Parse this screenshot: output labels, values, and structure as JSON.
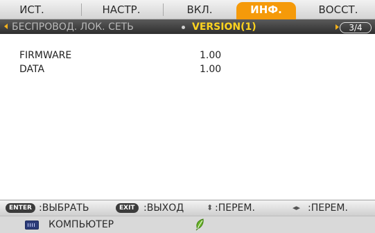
{
  "tabs": [
    {
      "label": "ИСТ.",
      "active": false
    },
    {
      "label": "НАСТР.",
      "active": false
    },
    {
      "label": "ВКЛ.",
      "active": false
    },
    {
      "label": "ИНФ.",
      "active": true
    },
    {
      "label": "ВОССТ.",
      "active": false
    }
  ],
  "subtabs": {
    "prev": "БЕСПРОВОД. ЛОК. СЕТЬ",
    "current": "VERSION(1)",
    "page": "3/4"
  },
  "info": [
    {
      "label": "FIRMWARE",
      "value": "1.00"
    },
    {
      "label": "DATA",
      "value": "1.00"
    }
  ],
  "keyhints": {
    "enter_key": "ENTER",
    "enter_label": ":ВЫБРАТЬ",
    "exit_key": "EXIT",
    "exit_label": ":ВЫХОД",
    "updown_glyph": "⬍",
    "updown_label": ":ПЕРЕМ.",
    "leftright_glyph": "◂▸",
    "leftright_label": ":ПЕРЕМ."
  },
  "source": {
    "label": "КОМПЬЮТЕР"
  },
  "colors": {
    "active_tab": "#f59a0a",
    "active_subtab_text": "#ffd41f",
    "nav_arrow": "#f5b21b",
    "eco_leaf": "#6bb52a"
  },
  "icons": {
    "source": "computer-input-icon",
    "eco": "eco-leaf-icon"
  }
}
